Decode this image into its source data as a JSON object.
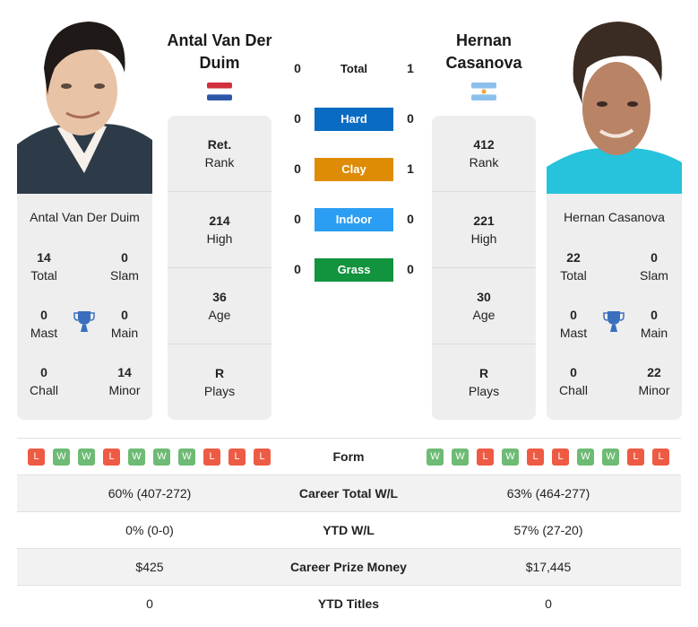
{
  "players": {
    "left": {
      "name": "Antal Van Der Duim",
      "name_display_line1": "Antal Van Der",
      "name_display_line2": "Duim",
      "country": "Netherlands",
      "flag_icon": "netherlands-flag-icon",
      "rank": {
        "value": "Ret.",
        "label": "Rank"
      },
      "high": {
        "value": "214",
        "label": "High"
      },
      "age": {
        "value": "36",
        "label": "Age"
      },
      "plays": {
        "value": "R",
        "label": "Plays"
      },
      "titles": {
        "total": {
          "value": "14",
          "label": "Total"
        },
        "slam": {
          "value": "0",
          "label": "Slam"
        },
        "mast": {
          "value": "0",
          "label": "Mast"
        },
        "main": {
          "value": "0",
          "label": "Main"
        },
        "chall": {
          "value": "0",
          "label": "Chall"
        },
        "minor": {
          "value": "14",
          "label": "Minor"
        }
      },
      "form": [
        "L",
        "W",
        "W",
        "L",
        "W",
        "W",
        "W",
        "L",
        "L",
        "L"
      ]
    },
    "right": {
      "name": "Hernan Casanova",
      "name_display_line1": "Hernan",
      "name_display_line2": "Casanova",
      "country": "Argentina",
      "flag_icon": "argentina-flag-icon",
      "rank": {
        "value": "412",
        "label": "Rank"
      },
      "high": {
        "value": "221",
        "label": "High"
      },
      "age": {
        "value": "30",
        "label": "Age"
      },
      "plays": {
        "value": "R",
        "label": "Plays"
      },
      "titles": {
        "total": {
          "value": "22",
          "label": "Total"
        },
        "slam": {
          "value": "0",
          "label": "Slam"
        },
        "mast": {
          "value": "0",
          "label": "Mast"
        },
        "main": {
          "value": "0",
          "label": "Main"
        },
        "chall": {
          "value": "0",
          "label": "Chall"
        },
        "minor": {
          "value": "22",
          "label": "Minor"
        }
      },
      "form": [
        "W",
        "W",
        "L",
        "W",
        "L",
        "L",
        "W",
        "W",
        "L",
        "L"
      ]
    }
  },
  "h2h": [
    {
      "label": "Total",
      "left": "0",
      "right": "1",
      "color": ""
    },
    {
      "label": "Hard",
      "left": "0",
      "right": "0",
      "color": "#0a6bc2"
    },
    {
      "label": "Clay",
      "left": "0",
      "right": "1",
      "color": "#de8c05"
    },
    {
      "label": "Indoor",
      "left": "0",
      "right": "0",
      "color": "#2b9ef3"
    },
    {
      "label": "Grass",
      "left": "0",
      "right": "0",
      "color": "#12933d"
    }
  ],
  "form_label": "Form",
  "comparison": [
    {
      "label": "Career Total W/L",
      "left": "60% (407-272)",
      "right": "63% (464-277)"
    },
    {
      "label": "YTD W/L",
      "left": "0% (0-0)",
      "right": "57% (27-20)"
    },
    {
      "label": "Career Prize Money",
      "left": "$425",
      "right": "$17,445"
    },
    {
      "label": "YTD Titles",
      "left": "0",
      "right": "0"
    }
  ],
  "colors": {
    "win": "#6dbb74",
    "loss": "#ee5b44",
    "trophy": "#3a6fc0",
    "card_bg": "#eeeeee"
  }
}
